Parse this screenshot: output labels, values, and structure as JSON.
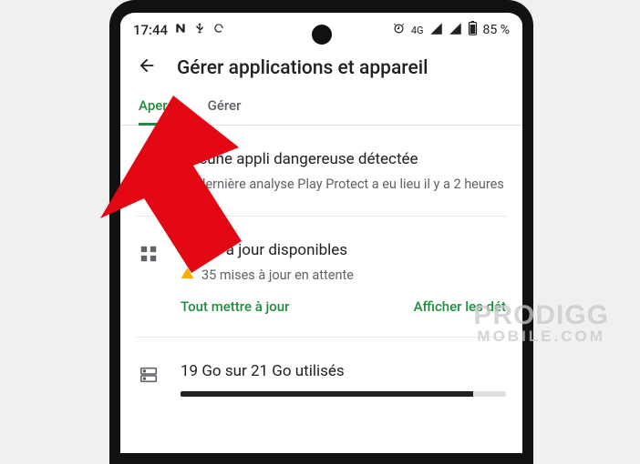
{
  "status_bar": {
    "time": "17:44",
    "network": "4G",
    "battery_pct": "85 %"
  },
  "header": {
    "title": "Gérer applications et appareil"
  },
  "tabs": {
    "overview": "Aperçu",
    "manage": "Gérer"
  },
  "protect": {
    "title": "Aucune appli dangereuse détectée",
    "subtitle": "La dernière analyse Play Protect a eu lieu il y a 2 heures"
  },
  "updates": {
    "title": "Mises à jour disponibles",
    "pending": "35 mises à jour en attente",
    "update_all": "Tout mettre à jour",
    "view_details": "Afficher les dét"
  },
  "storage": {
    "title": "19 Go sur 21 Go utilisés",
    "used_pct": 90
  },
  "watermark": {
    "line1": "PRODIGG",
    "line2": "MOBILE.COM"
  }
}
